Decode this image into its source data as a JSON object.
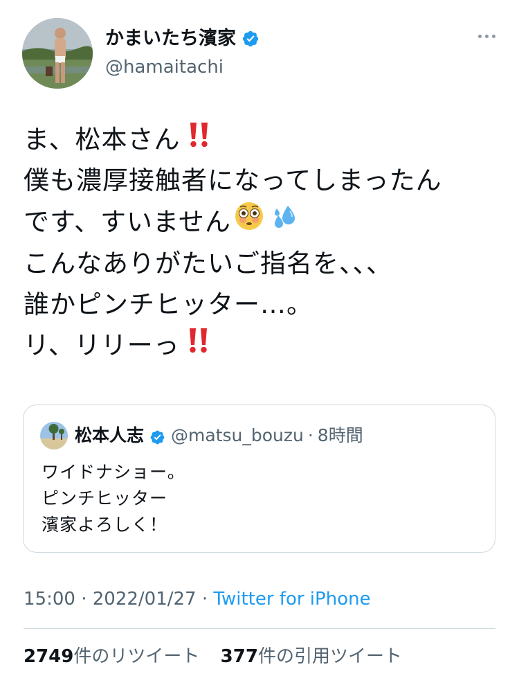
{
  "author": {
    "display_name": "かまいたち濱家",
    "handle": "@hamaitachi"
  },
  "tweet": {
    "lines": [
      "ま、松本さん",
      "僕も濃厚接触者になってしまったん",
      "です、すいません",
      "こんなありがたいご指名を、、、",
      "誰かピンチヒッター…。",
      "リ、リリーっ"
    ]
  },
  "quoted": {
    "display_name": "松本人志",
    "handle": "@matsu_bouzu",
    "separator": "·",
    "time": "8時間",
    "lines": [
      "ワイドナショー。",
      "ピンチヒッター",
      "濱家よろしく！"
    ]
  },
  "meta": {
    "time": "15:00",
    "date": "2022/01/27",
    "separator": "·",
    "source": "Twitter for iPhone"
  },
  "stats": {
    "retweets_count": "2749",
    "retweets_label": "件のリツイート",
    "quotes_count": "377",
    "quotes_label": "件の引用ツイート"
  },
  "colors": {
    "accent": "#1d9bf0",
    "secondary_text": "#536471",
    "border": "#cfd9de",
    "emoji_red": "#e0282e"
  },
  "icons": [
    "verified-badge-icon",
    "more-icon",
    "double-exclamation-icon",
    "flushed-face-icon",
    "sweat-droplets-icon"
  ]
}
